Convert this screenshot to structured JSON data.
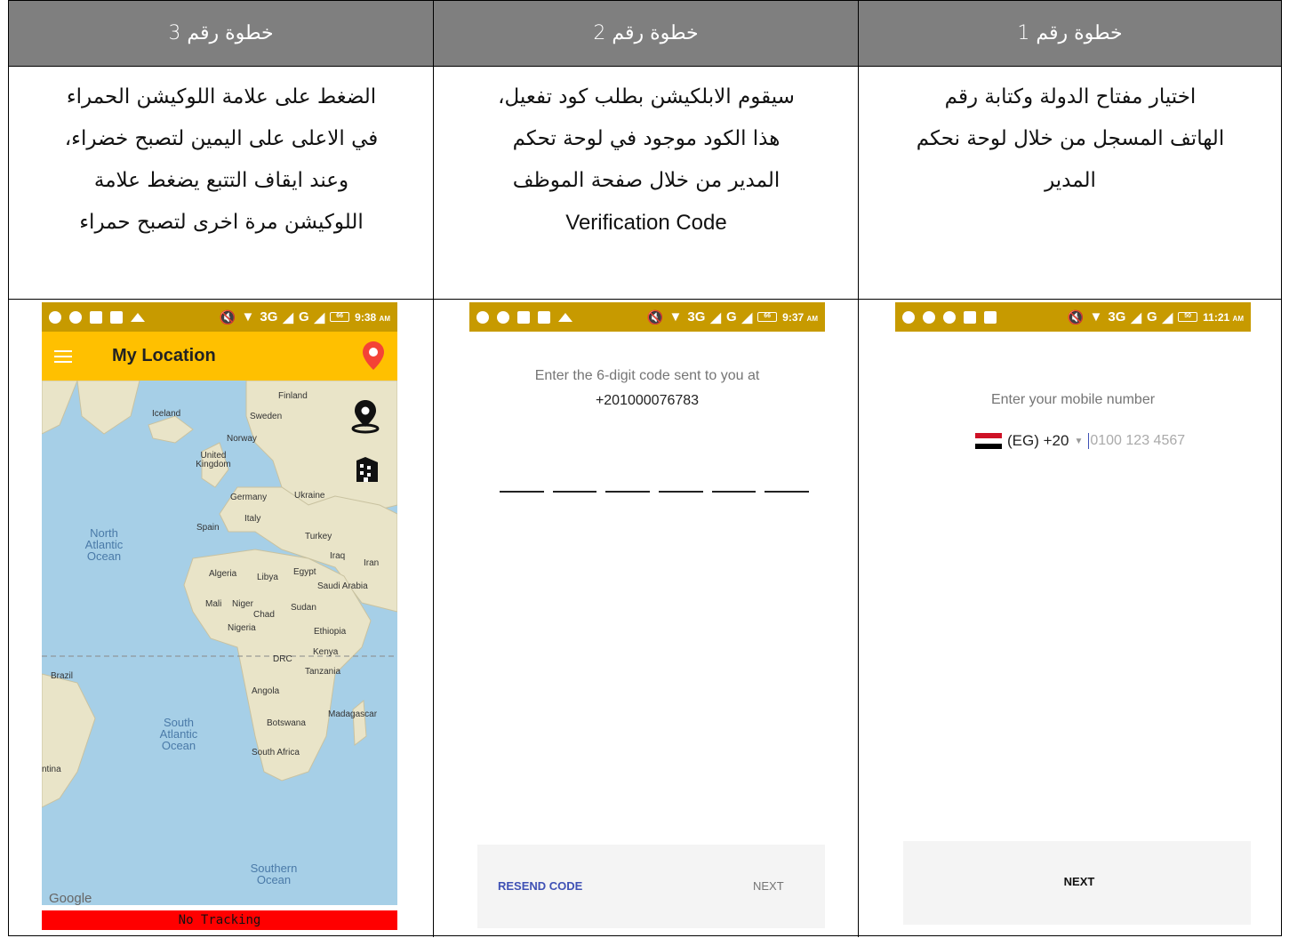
{
  "headers": {
    "step3": "خطوة رقم 3",
    "step2": "خطوة رقم 2",
    "step1": "خطوة رقم 1"
  },
  "descriptions": {
    "step3": [
      "الضغط على علامة اللوكيشن الحمراء",
      "في الاعلى على اليمين لتصبح خضراء،",
      "وعند ايقاف التتبع يضغط علامة",
      "اللوكيشن مرة اخرى لتصبح حمراء"
    ],
    "step2": [
      "سيقوم الابلكيشن بطلب كود تفعيل،",
      "هذا الكود موجود في لوحة تحكم",
      "المدير من خلال صفحة الموظف",
      "Verification Code"
    ],
    "step1": [
      "اختيار مفتاح الدولة وكتابة رقم",
      "الهاتف المسجل من خلال لوحة نحكم",
      "المدير"
    ]
  },
  "screens": {
    "step3": {
      "time": "9:38",
      "ampm": "AM",
      "battery": "66",
      "network": "3G",
      "app_title": "My Location",
      "status_text": "No Tracking",
      "map_labels": {
        "finland": "Finland",
        "iceland": "Iceland",
        "sweden": "Sweden",
        "norway": "Norway",
        "uk": "United Kingdom",
        "germany": "Germany",
        "ukraine": "Ukraine",
        "italy": "Italy",
        "spain": "Spain",
        "turkey": "Turkey",
        "north_atlantic": "North Atlantic Ocean",
        "iraq": "Iraq",
        "iran": "Iran",
        "algeria": "Algeria",
        "libya": "Libya",
        "egypt": "Egypt",
        "saudi": "Saudi Arabia",
        "mali": "Mali",
        "niger": "Niger",
        "chad": "Chad",
        "sudan": "Sudan",
        "nigeria": "Nigeria",
        "ethiopia": "Ethiopia",
        "drc": "DRC",
        "kenya": "Kenya",
        "tanzania": "Tanzania",
        "brazil": "Brazil",
        "angola": "Angola",
        "madagascar": "Madagascar",
        "botswana": "Botswana",
        "south_atlantic": "South Atlantic Ocean",
        "south_africa": "South Africa",
        "argentina": "ntina",
        "southern_ocean": "Southern Ocean",
        "google": "Google"
      }
    },
    "step2": {
      "time": "9:37",
      "ampm": "AM",
      "battery": "66",
      "network": "3G",
      "prompt": "Enter the 6-digit code sent to you at",
      "phone_number": "+201000076783",
      "code_slots": 6,
      "resend_label": "RESEND CODE",
      "next_label": "NEXT"
    },
    "step1": {
      "time": "11:21",
      "ampm": "AM",
      "battery": "50",
      "network": "3G",
      "prompt": "Enter your mobile number",
      "country": "(EG) +20",
      "placeholder": "0100 123 4567",
      "next_label": "NEXT"
    }
  },
  "colors": {
    "header_bg": "#7f7f7f",
    "status_bar": "#c79a00",
    "app_bar": "#ffc000",
    "pin_red": "#f44336",
    "tracking_bar": "#ff0000",
    "ocean": "#a6cfe7",
    "land": "#e9e4c8"
  }
}
